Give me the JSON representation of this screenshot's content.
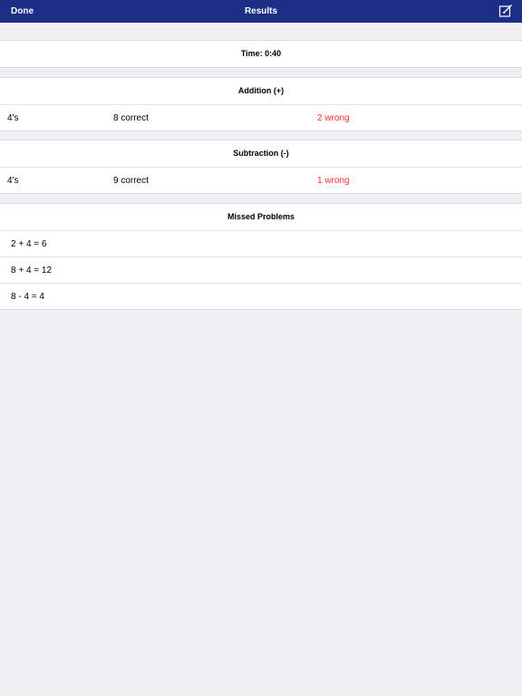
{
  "navbar": {
    "left_label": "Done",
    "title": "Results",
    "right_icon": "compose-icon",
    "color": "#1b2f87"
  },
  "time": {
    "label": "Time: 0:40"
  },
  "addition": {
    "title": "Addition (+)",
    "rows": [
      {
        "table": "4's",
        "correct": "8 correct",
        "wrong": "2 wrong"
      }
    ]
  },
  "subtraction": {
    "title": "Subtraction (-)",
    "rows": [
      {
        "table": "4's",
        "correct": "9 correct",
        "wrong": "1 wrong"
      }
    ]
  },
  "missed": {
    "title": "Missed Problems",
    "items": [
      "2 + 4 = 6",
      "8 + 4 = 12",
      "8 - 4 = 4"
    ]
  },
  "colors": {
    "wrong": "#ff2d2d",
    "background": "#efeff4"
  }
}
